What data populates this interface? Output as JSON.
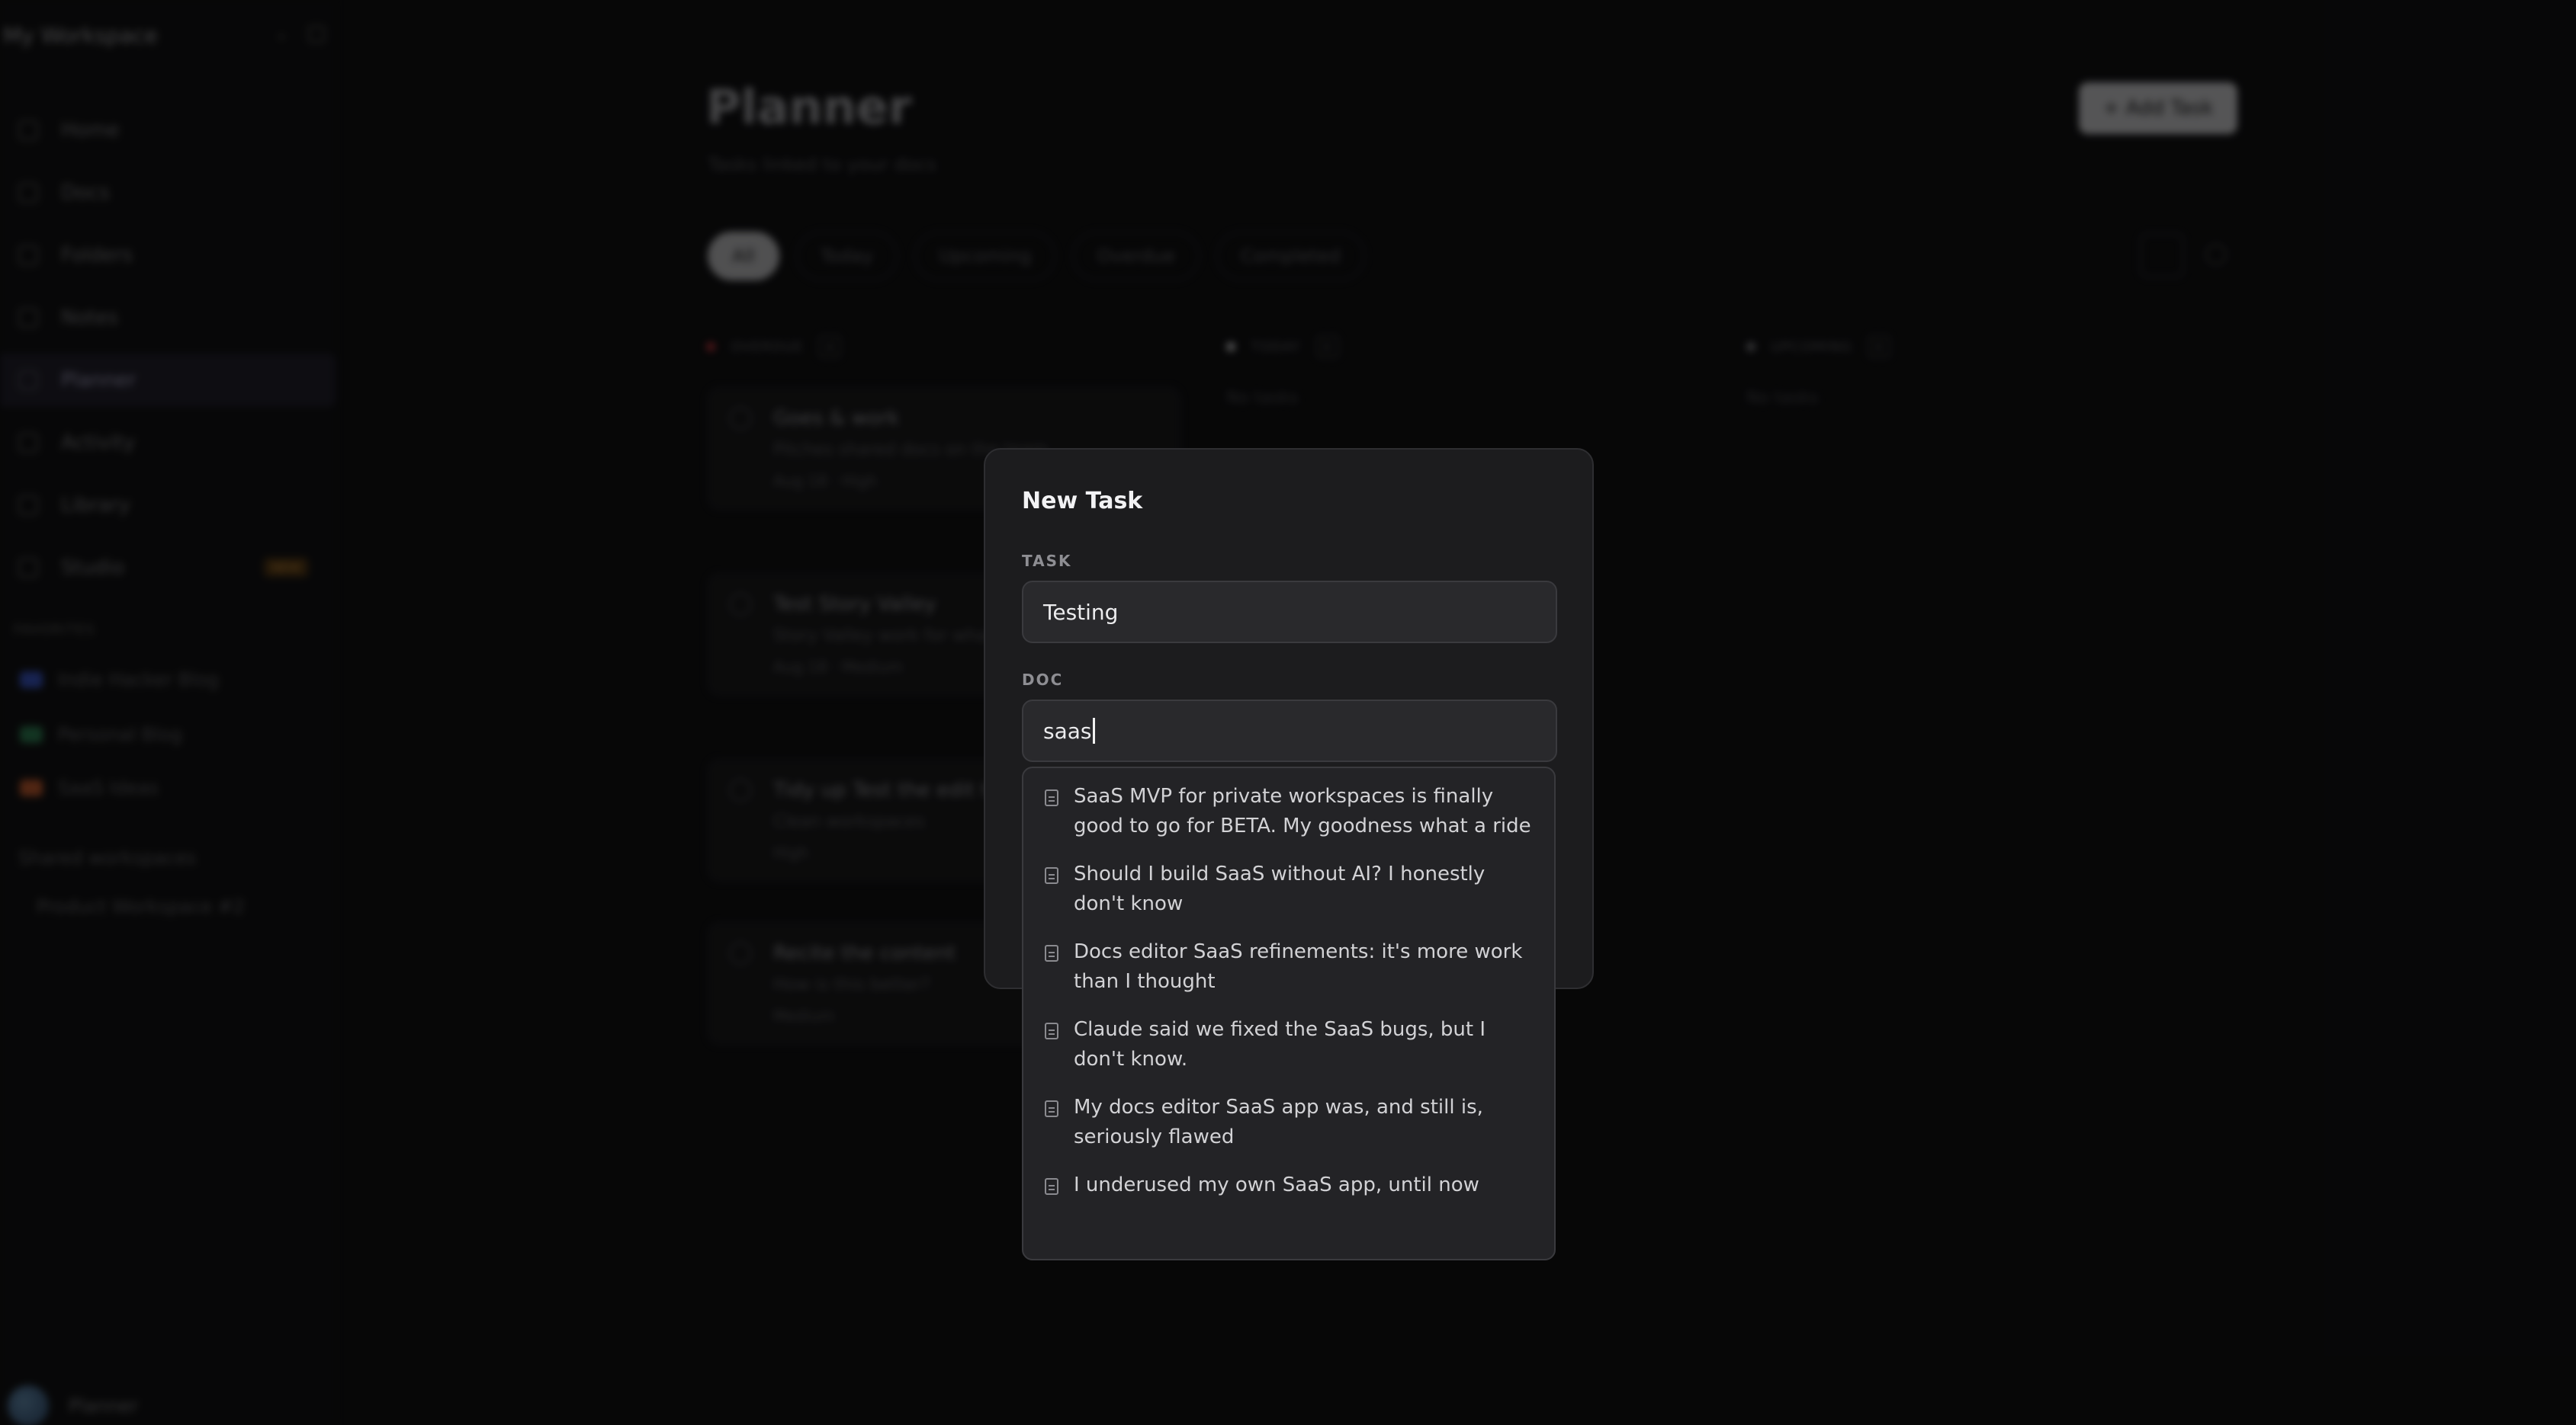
{
  "workspace": {
    "title": "My Workspace"
  },
  "sidebar": {
    "items": [
      {
        "label": "Home"
      },
      {
        "label": "Docs"
      },
      {
        "label": "Folders"
      },
      {
        "label": "Notes"
      },
      {
        "label": "Planner"
      },
      {
        "label": "Activity"
      },
      {
        "label": "Library"
      },
      {
        "label": "Studio",
        "badge": "NEW"
      }
    ],
    "favorites_heading": "FAVORITES",
    "favorites": [
      {
        "label": "Indie Hacker Blog",
        "color": "#3b5bd9"
      },
      {
        "label": "Personal Blog",
        "color": "#2e8b57"
      },
      {
        "label": "SaaS Ideas",
        "color": "#d9622e"
      }
    ],
    "shared_heading": "Shared workspaces",
    "shared_item": "Product Workspace #2",
    "user_name": "Planner"
  },
  "page": {
    "title": "Planner",
    "subtitle": "Tasks linked to your docs",
    "add_task_label": "+ Add Task",
    "filters": [
      "All",
      "Today",
      "Upcoming",
      "Overdue",
      "Completed"
    ],
    "columns": [
      {
        "label": "OVERDUE",
        "count": "4",
        "color": "#d9363e"
      },
      {
        "label": "TODAY",
        "count": "0",
        "color": "#e6e6e8"
      },
      {
        "label": "UPCOMING",
        "count": "0",
        "color": "#8e8e93"
      }
    ],
    "no_tasks": "No tasks",
    "cards": [
      {
        "title": "Goes & work",
        "doc": "Pitches shared docs on the team",
        "meta": "Aug 18 · High"
      },
      {
        "title": "Test Story Valley",
        "doc": "Story Valley work for what you also learn?",
        "meta": "Aug 18 · Medium"
      },
      {
        "title": "Tidy up Test the edit tool",
        "doc": "Clean workspaces",
        "meta": "High"
      },
      {
        "title": "Recite the content",
        "doc": "How is this better?",
        "meta": "Medium"
      }
    ]
  },
  "modal": {
    "title": "New Task",
    "task_label": "TASK",
    "task_value": "Testing",
    "doc_label": "DOC",
    "doc_value": "saas",
    "suggestions": [
      "SaaS MVP for private workspaces is finally good to go for BETA. My goodness what a ride",
      "Should I build SaaS without AI? I honestly don't know",
      "Docs editor SaaS refinements: it's more work than I thought",
      "Claude said we fixed the SaaS bugs, but I don't know.",
      "My docs editor SaaS app was, and still is, seriously flawed",
      "I underused my own SaaS app, until now"
    ]
  }
}
